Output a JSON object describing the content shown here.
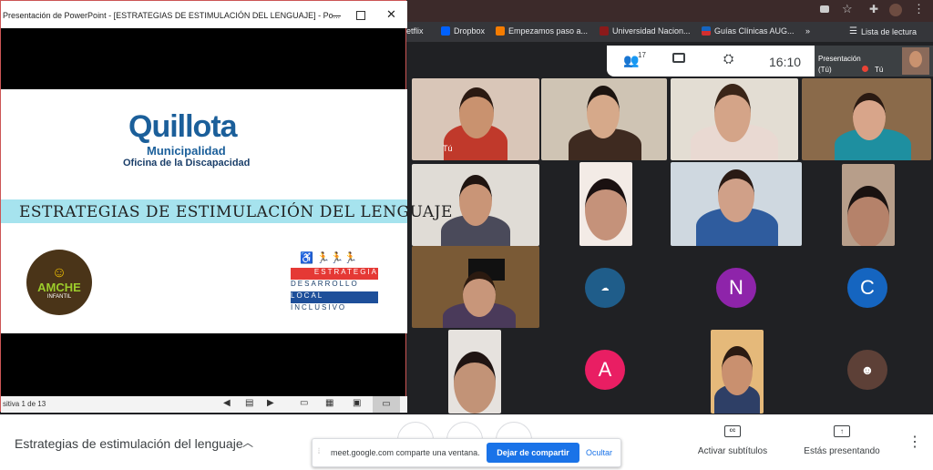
{
  "ppt": {
    "title": "Presentación de PowerPoint - [ESTRATEGIAS DE ESTIMULACIÓN DEL LENGUAJE] - Po...",
    "status": "sitiva 1 de 13"
  },
  "slide": {
    "brand": "Quillota",
    "sub1": "Municipalidad",
    "sub2": "Oficina de la Discapacidad",
    "banner": "ESTRATEGIAS DE ESTIMULACIÓN DEL LENGUAJE",
    "logo_left_word": "AMCHE",
    "logo_left_sub": "INFANTIL",
    "strategy_rows": [
      "ESTRATEGIA",
      "DESARROLLO",
      "LOCAL",
      "INCLUSIVO"
    ]
  },
  "bookmarks": [
    {
      "label": "etflix",
      "icon": "netflix-icon",
      "color": "#e50914"
    },
    {
      "label": "Dropbox",
      "icon": "dropbox-icon",
      "color": "#0061fe"
    },
    {
      "label": "Empezamos paso a...",
      "icon": "blogger-icon",
      "color": "#f57c00"
    },
    {
      "label": "Universidad Nacion...",
      "icon": "university-icon",
      "color": "#8b1a1a"
    },
    {
      "label": "Guías Clínicas AUG...",
      "icon": "flag-icon",
      "color": "#d32f2f"
    },
    {
      "label": "Lista de lectura",
      "icon": "reading-list-icon",
      "color": "#e8eaed"
    }
  ],
  "meet": {
    "participants_count": "17",
    "time": "16:10",
    "presentation_label": "Presentación",
    "presentation_you": "(Tú)",
    "self_label": "Tú",
    "self_tile_label": "Tú",
    "avatars": [
      {
        "letter": "N",
        "color": "#8e24aa"
      },
      {
        "letter": "C",
        "color": "#1565c0"
      },
      {
        "letter": "A",
        "color": "#e91e63"
      }
    ]
  },
  "bottom": {
    "meeting_name": "Estrategias de estimulación del lenguaje",
    "share_text": "meet.google.com comparte una ventana.",
    "stop_share": "Dejar de compartir",
    "hide": "Ocultar",
    "captions": "Activar subtítulos",
    "presenting": "Estás presentando"
  }
}
